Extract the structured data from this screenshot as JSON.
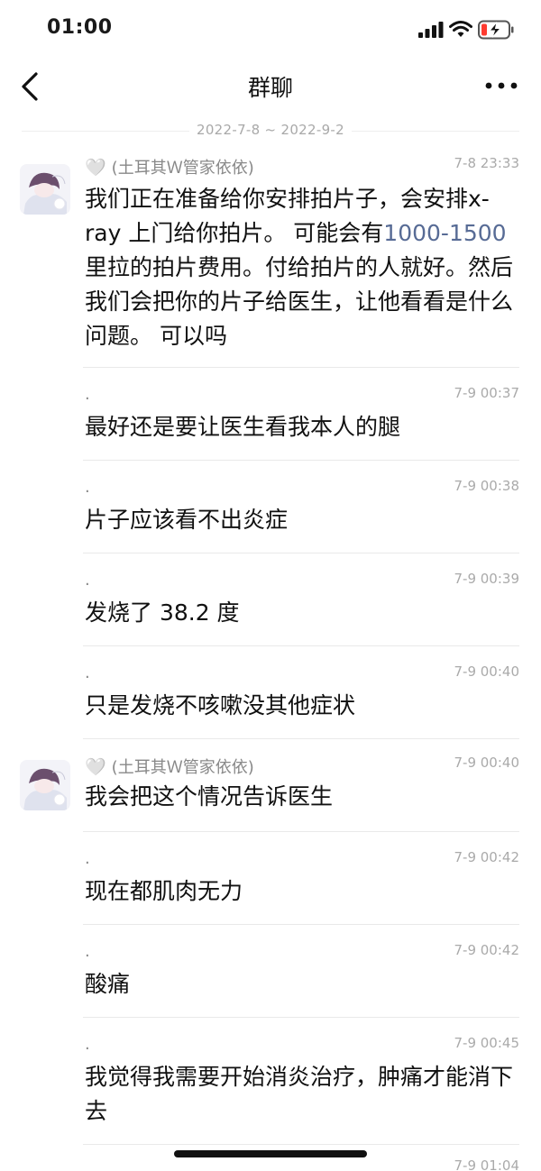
{
  "status_bar": {
    "time": "01:00"
  },
  "nav": {
    "title": "群聊"
  },
  "date_range": "2022-7-8 ~ 2022-9-2",
  "messages": [
    {
      "sender": "(土耳其Ｗ管家依依)",
      "time": "7-8 23:33",
      "text_a": "我们正在准备给你安排拍片子，会安排x-ray 上门给你拍片。 可能会有",
      "text_link": "1000-1500",
      "text_b": "里拉的拍片费用。付给拍片的人就好。然后我们会把你的片子给医生，让他看看是什么问题。 可以吗"
    },
    {
      "sender": ".",
      "time": "7-9 00:37",
      "text": "最好还是要让医生看我本人的腿"
    },
    {
      "sender": ".",
      "time": "7-9 00:38",
      "text": "片子应该看不出炎症"
    },
    {
      "sender": ".",
      "time": "7-9 00:39",
      "text": "发烧了 38.2 度"
    },
    {
      "sender": ".",
      "time": "7-9 00:40",
      "text": "只是发烧不咳嗽没其他症状"
    },
    {
      "sender": "(土耳其Ｗ管家依依)",
      "time": "7-9 00:40",
      "text": "我会把这个情况告诉医生"
    },
    {
      "sender": ".",
      "time": "7-9 00:42",
      "text": "现在都肌肉无力"
    },
    {
      "sender": ".",
      "time": "7-9 00:42",
      "text": "酸痛"
    },
    {
      "sender": ".",
      "time": "7-9 00:45",
      "text": "我觉得我需要开始消炎治疗，肿痛才能消下去"
    },
    {
      "sender": "",
      "time": "7-9 01:04",
      "text": ""
    }
  ],
  "icons": [
    "signal-icon",
    "wifi-icon",
    "battery-charging-icon",
    "back-chevron-icon",
    "more-icon",
    "avatar-icon",
    "heart-icon"
  ],
  "colors": {
    "link": "#576b95",
    "battery_low": "#ff3b30"
  }
}
